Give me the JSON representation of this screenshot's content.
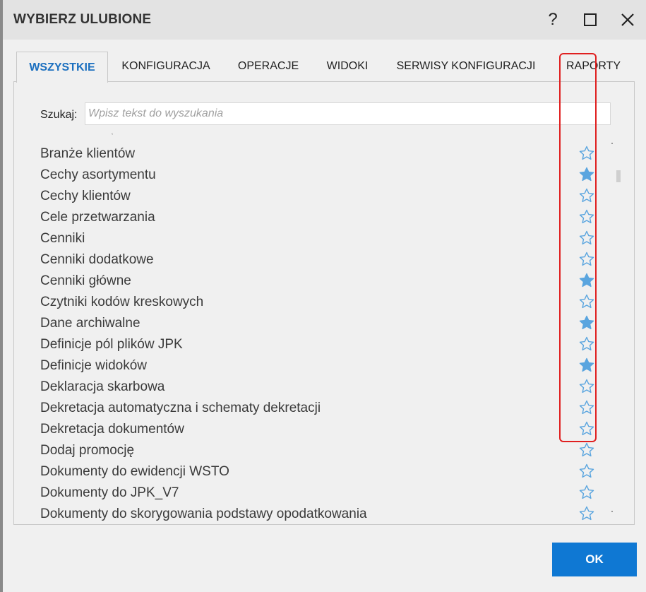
{
  "dialog": {
    "title": "WYBIERZ ULUBIONE",
    "help_glyph": "?",
    "ok_label": "OK"
  },
  "tabs": [
    {
      "label": "WSZYSTKIE",
      "active": true
    },
    {
      "label": "KONFIGURACJA",
      "active": false
    },
    {
      "label": "OPERACJE",
      "active": false
    },
    {
      "label": "WIDOKI",
      "active": false
    },
    {
      "label": "SERWISY KONFIGURACJI",
      "active": false
    },
    {
      "label": "RAPORTY",
      "active": false
    }
  ],
  "search": {
    "label": "Szukaj:",
    "placeholder": "Wpisz tekst do wyszukania",
    "value": ""
  },
  "list": {
    "partial_top_glyph": "ʿ",
    "items": [
      {
        "label": "Branże klientów",
        "favorite": false
      },
      {
        "label": "Cechy asortymentu",
        "favorite": true
      },
      {
        "label": "Cechy klientów",
        "favorite": false
      },
      {
        "label": "Cele przetwarzania",
        "favorite": false
      },
      {
        "label": "Cenniki",
        "favorite": false
      },
      {
        "label": "Cenniki dodatkowe",
        "favorite": false
      },
      {
        "label": "Cenniki główne",
        "favorite": true
      },
      {
        "label": "Czytniki kodów kreskowych",
        "favorite": false
      },
      {
        "label": "Dane archiwalne",
        "favorite": true
      },
      {
        "label": "Definicje pól plików JPK",
        "favorite": false
      },
      {
        "label": "Definicje widoków",
        "favorite": true
      },
      {
        "label": "Deklaracja skarbowa",
        "favorite": false
      },
      {
        "label": "Dekretacja automatyczna i schematy dekretacji",
        "favorite": false
      },
      {
        "label": "Dekretacja dokumentów",
        "favorite": false
      },
      {
        "label": "Dodaj promocję",
        "favorite": false
      },
      {
        "label": "Dokumenty do ewidencji WSTO",
        "favorite": false
      },
      {
        "label": "Dokumenty do JPK_V7",
        "favorite": false
      },
      {
        "label": "Dokumenty do skorygowania podstawy opodatkowania",
        "favorite": false
      }
    ]
  },
  "colors": {
    "accent": "#0f78d3",
    "star": "#5aa5df",
    "highlight": "#e02020"
  }
}
